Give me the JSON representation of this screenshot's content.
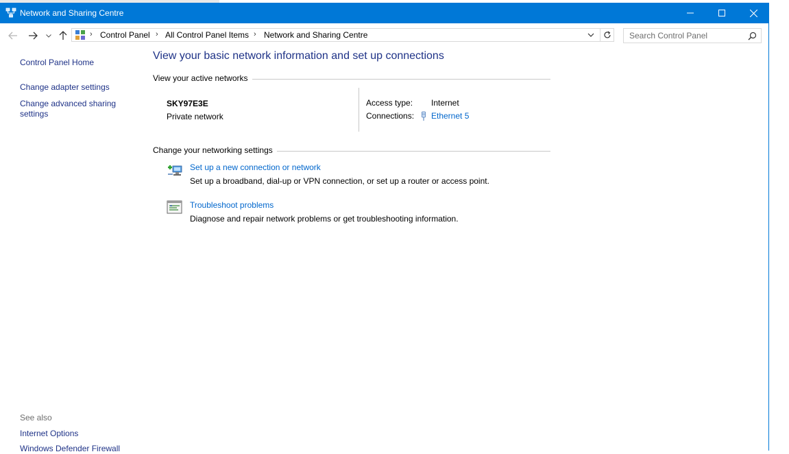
{
  "window": {
    "title": "Network and Sharing Centre",
    "title_bar_color": "#0078d7"
  },
  "address_bar": {
    "icon": "control-panel-icon",
    "breadcrumbs": [
      "Control Panel",
      "All Control Panel Items",
      "Network and Sharing Centre"
    ],
    "search_placeholder": "Search Control Panel"
  },
  "sidebar": {
    "links": [
      {
        "label": "Control Panel Home"
      },
      {
        "label": "Change adapter settings"
      },
      {
        "label": "Change advanced sharing settings",
        "line1": "Change advanced sharing",
        "line2": "settings"
      }
    ],
    "see_also_title": "See also",
    "see_also_links": [
      {
        "label": "Internet Options"
      },
      {
        "label": "Windows Defender Firewall"
      }
    ]
  },
  "main": {
    "title": "View your basic network information and set up connections",
    "active_networks_heading": "View your active networks",
    "network": {
      "name": "SKY97E3E",
      "type": "Private network",
      "access_type_label": "Access type:",
      "access_type_value": "Internet",
      "connections_label": "Connections:",
      "connections_value": "Ethernet 5"
    },
    "settings_heading": "Change your networking settings",
    "tasks": [
      {
        "icon": "new-connection-icon",
        "link": "Set up a new connection or network",
        "description": "Set up a broadband, dial-up or VPN connection, or set up a router or access point."
      },
      {
        "icon": "troubleshoot-icon",
        "link": "Troubleshoot problems",
        "description": "Diagnose and repair network problems or get troubleshooting information."
      }
    ]
  },
  "colors": {
    "link": "#0066cc",
    "nav_link": "#1e3287",
    "accent": "#0078d7"
  }
}
